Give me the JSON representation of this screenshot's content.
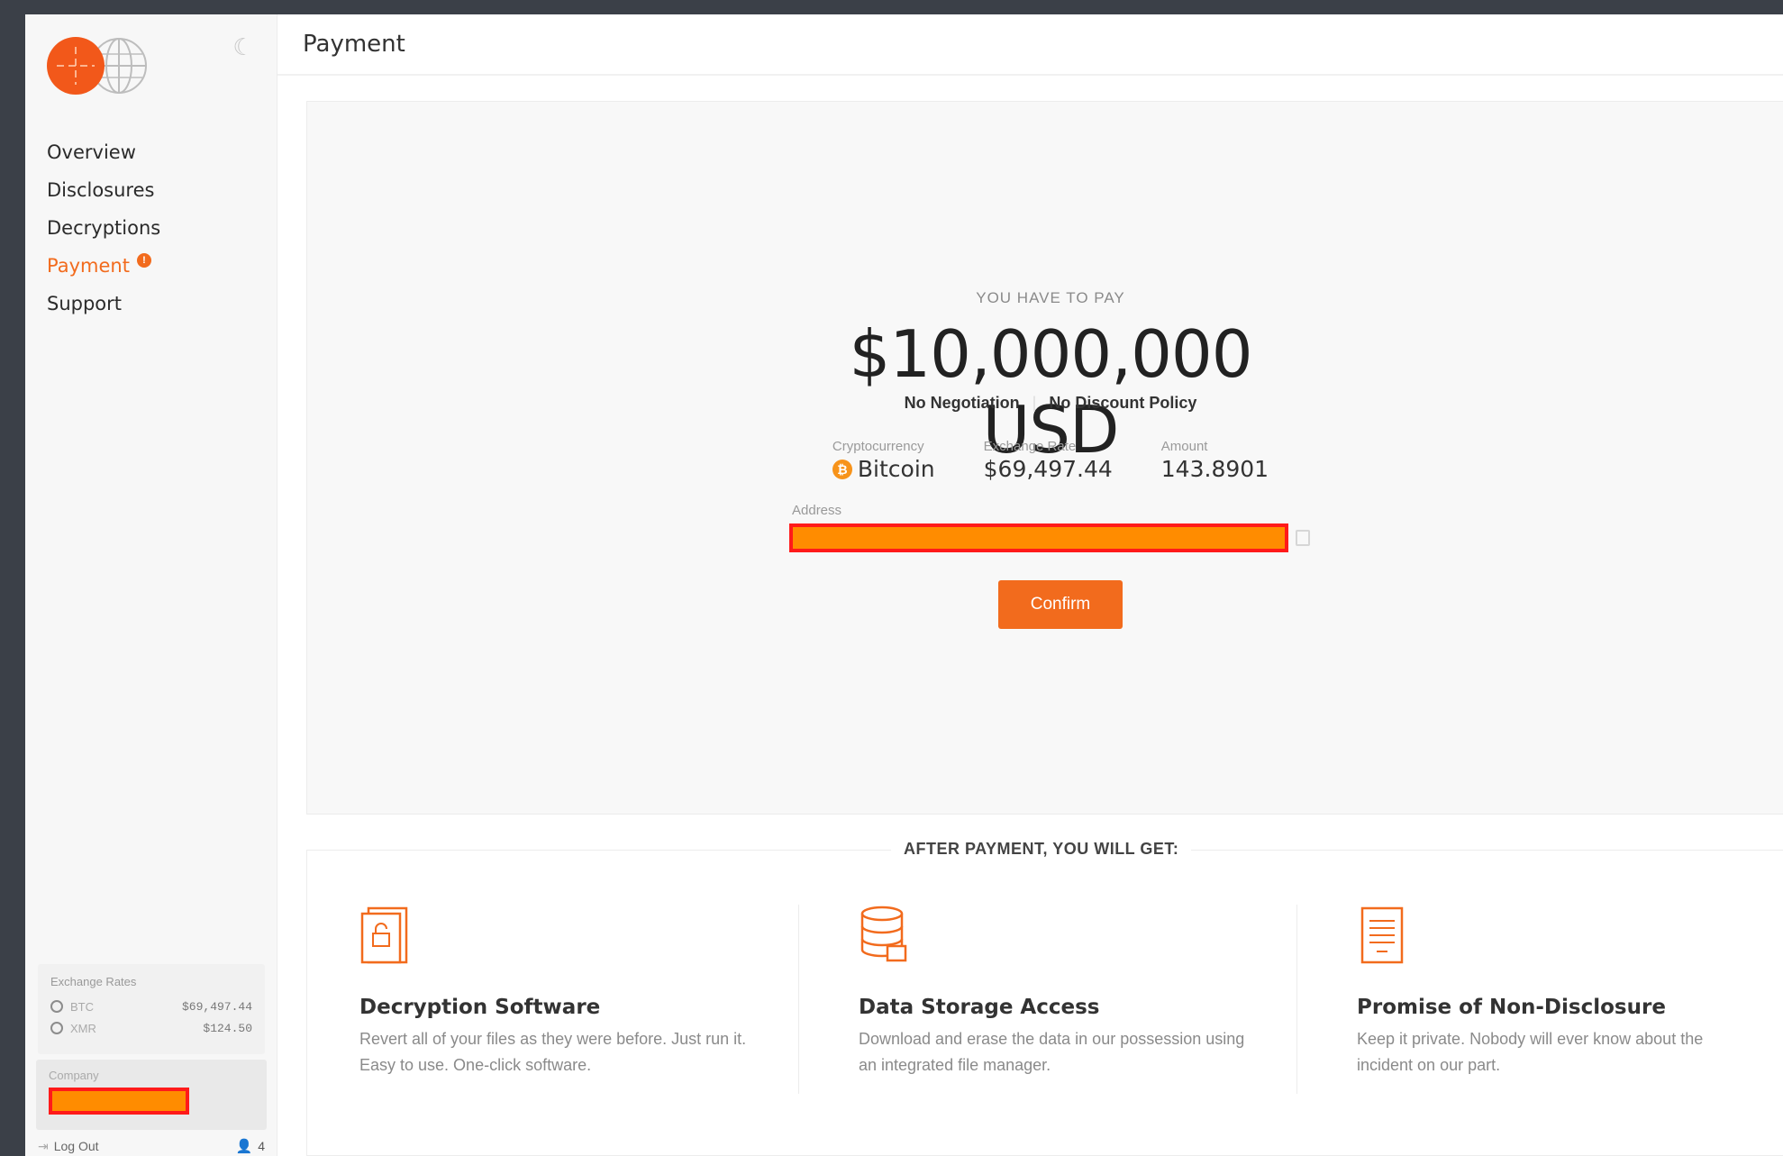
{
  "sidebar": {
    "nav": [
      {
        "label": "Overview",
        "active": false
      },
      {
        "label": "Disclosures",
        "active": false
      },
      {
        "label": "Decryptions",
        "active": false
      },
      {
        "label": "Payment",
        "active": true,
        "badge": "!"
      },
      {
        "label": "Support",
        "active": false
      }
    ],
    "exchange_rates": {
      "title": "Exchange Rates",
      "rows": [
        {
          "coin": "BTC",
          "value": "$69,497.44"
        },
        {
          "coin": "XMR",
          "value": "$124.50"
        }
      ]
    },
    "company": {
      "label": "Company"
    },
    "logout_label": "Log Out",
    "users_count": "4"
  },
  "header": {
    "title": "Payment"
  },
  "payment": {
    "prompt": "YOU HAVE TO PAY",
    "amount": "$10,000,000 USD",
    "policy": [
      "No Negotiation",
      "No Discount Policy"
    ],
    "crypto": {
      "cryptocurrency_label": "Cryptocurrency",
      "cryptocurrency_value": "Bitcoin",
      "exchange_rate_label": "Exchange Rate",
      "exchange_rate_value": "$69,497.44",
      "amount_label": "Amount",
      "amount_value": "143.8901"
    },
    "address_label": "Address",
    "confirm_label": "Confirm"
  },
  "after_payment": {
    "title": "AFTER PAYMENT, YOU WILL GET:",
    "features": [
      {
        "icon": "decryption-file-icon",
        "title": "Decryption Software",
        "description": "Revert all of your files as they were before. Just run it. Easy to use. One-click software."
      },
      {
        "icon": "database-icon",
        "title": "Data Storage Access",
        "description": "Download and erase the data in our possession using an integrated file manager."
      },
      {
        "icon": "document-icon",
        "title": "Promise of Non-Disclosure",
        "description": "Keep it private. Nobody will ever know about the incident on our part."
      }
    ]
  },
  "colors": {
    "accent": "#f26b1d",
    "redaction_fill": "#ff8c00",
    "redaction_border": "#ff1a1a"
  }
}
